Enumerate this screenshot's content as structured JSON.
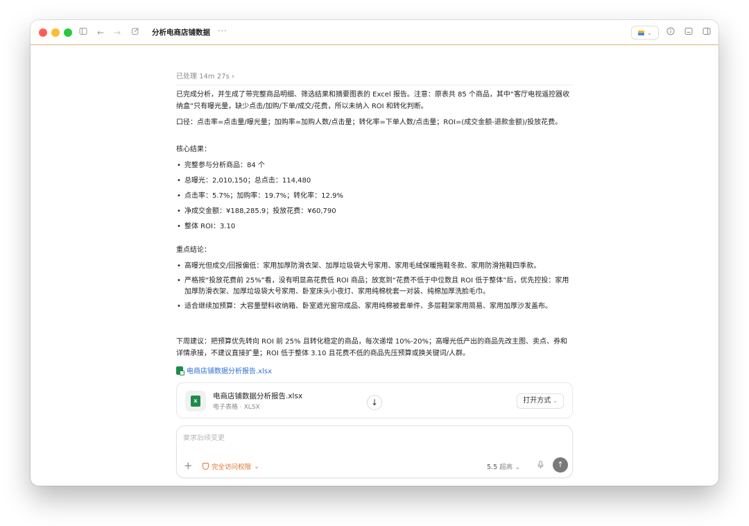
{
  "titlebar": {
    "title": "分析电商店铺数据",
    "more": "···"
  },
  "thread": {
    "processed": "已处理 14m 27s",
    "summary": "已完成分析，并生成了带完整商品明细、筛选结果和摘要图表的 Excel 报告。注意：原表共 85 个商品，其中“客厅电视遥控器收纳盒”只有曝光量，缺少点击/加购/下单/成交/花费，所以未纳入 ROI 和转化判断。",
    "caliber": "口径：点击率=点击量/曝光量；加购率=加购人数/点击量；转化率=下单人数/点击量；ROI=(成交金额-退款金额)/投放花费。",
    "core_heading": "核心结果：",
    "core_items": [
      "完整参与分析商品：84 个",
      "总曝光：2,010,150；总点击：114,480",
      "点击率：5.7%；加购率：19.7%；转化率：12.9%",
      "净成交金额：¥188,285.9；投放花费：¥60,790",
      "整体 ROI：3.10"
    ],
    "key_heading": "重点结论：",
    "key_items": [
      "高曝光但成交/回报偏低：家用加厚防滑衣架、加厚垃圾袋大号家用、家用毛绒保暖拖鞋冬款、家用防滑拖鞋四季款。",
      "严格按“投放花费前 25%”看，没有明显高花费低 ROI 商品；放宽到“花费不低于中位数且 ROI 低于整体”后，优先控投：家用加厚防滑衣架、加厚垃圾袋大号家用、卧室床头小夜灯、家用纯棉枕套一对装、纯棉加厚洗脸毛巾。",
      "适合继续加预算：大容量塑料收纳箱、卧室遮光窗帘成品、家用纯棉被套单件、多层鞋架家用简易、家用加厚沙发盖布。"
    ],
    "next_week": "下周建议：把预算优先转向 ROI 前 25% 且转化稳定的商品，每次递增 10%-20%；高曝光低产出的商品先改主图、卖点、券和详情承接，不建议直接扩量；ROI 低于整体 3.10 且花费不低的商品先压预算或换关键词/人群。",
    "file_link": "电商店铺数据分析报告.xlsx",
    "file_card": {
      "name": "电商店铺数据分析报告.xlsx",
      "sub": "电子表格 · XLSX",
      "icon_letter": "x",
      "open_label": "打开方式"
    }
  },
  "composer": {
    "placeholder": "要求后续变更",
    "access_label": "完全访问权限",
    "model_label": "5.5",
    "model_sub": "超高"
  },
  "icons": {
    "sidebar": "sidebar-icon",
    "back": "arrow-left-icon",
    "forward": "arrow-right-icon",
    "compose": "edit-icon",
    "info": "info-icon",
    "terminal": "terminal-icon",
    "panel": "panel-icon",
    "download": "download-icon",
    "send": "arrow-up-icon"
  },
  "colors": {
    "accent_orange": "#e0722c",
    "link_blue": "#2f6fd6",
    "excel_green": "#1f8a4c",
    "titlebar_border": "#d6b86a"
  }
}
